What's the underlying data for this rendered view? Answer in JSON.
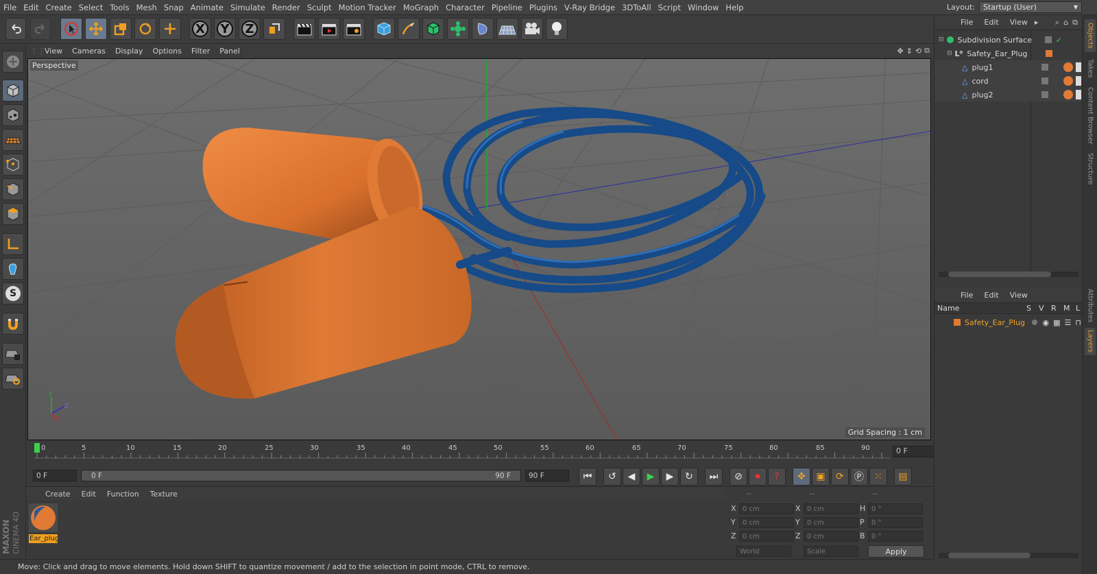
{
  "menubar": {
    "items": [
      "File",
      "Edit",
      "Create",
      "Select",
      "Tools",
      "Mesh",
      "Snap",
      "Animate",
      "Simulate",
      "Render",
      "Sculpt",
      "Motion Tracker",
      "MoGraph",
      "Character",
      "Pipeline",
      "Plugins",
      "V-Ray Bridge",
      "3DToAll",
      "Script",
      "Window",
      "Help"
    ],
    "layout_label": "Layout:",
    "layout_value": "Startup (User)"
  },
  "toolbar": {
    "x_label": "X",
    "y_label": "Y",
    "z_label": "Z"
  },
  "viewport": {
    "menu": [
      "View",
      "Cameras",
      "Display",
      "Options",
      "Filter",
      "Panel"
    ],
    "label": "Perspective",
    "grid_spacing": "Grid Spacing : 1 cm",
    "axis_y": "Y",
    "axis_z": "Z",
    "axis_x": "X",
    "colors": {
      "orange": "#e07a35",
      "blue": "#1a4d8a"
    }
  },
  "timeline": {
    "ticks": [
      "0",
      "5",
      "10",
      "15",
      "20",
      "25",
      "30",
      "35",
      "40",
      "45",
      "50",
      "55",
      "60",
      "65",
      "70",
      "75",
      "80",
      "85",
      "90"
    ],
    "end_field": "0 F"
  },
  "transport": {
    "current_frame": "0 F",
    "range_start": "0 F",
    "range_end": "90 F",
    "max_frame": "90 F"
  },
  "material_panel": {
    "menu": [
      "Create",
      "Edit",
      "Function",
      "Texture"
    ],
    "materials": [
      {
        "name": "Ear_plug"
      }
    ]
  },
  "coordinates": {
    "header_1": "--",
    "header_2": "--",
    "header_3": "--",
    "rows": [
      {
        "a": "X",
        "av": "0 cm",
        "b": "X",
        "bv": "0 cm",
        "c": "H",
        "cv": "0 °"
      },
      {
        "a": "Y",
        "av": "0 cm",
        "b": "Y",
        "bv": "0 cm",
        "c": "P",
        "cv": "0 °"
      },
      {
        "a": "Z",
        "av": "0 cm",
        "b": "Z",
        "bv": "0 cm",
        "c": "B",
        "cv": "0 °"
      }
    ],
    "mode_world": "World",
    "mode_scale": "Scale",
    "apply": "Apply"
  },
  "status": {
    "text": "Move: Click and drag to move elements. Hold down SHIFT to quantize movement / add to the selection in point mode, CTRL to remove."
  },
  "objects_panel": {
    "menu": [
      "File",
      "Edit",
      "View"
    ],
    "items": [
      {
        "name": "Subdivision Surface"
      },
      {
        "name": "Safety_Ear_Plug"
      },
      {
        "name": "plug1"
      },
      {
        "name": "cord"
      },
      {
        "name": "plug2"
      }
    ]
  },
  "layers_panel": {
    "menu": [
      "File",
      "Edit",
      "View"
    ],
    "col_name": "Name",
    "col_s": "S",
    "col_v": "V",
    "col_r": "R",
    "col_m": "M",
    "col_l": "L",
    "layers": [
      {
        "name": "Safety_Ear_Plug",
        "color": "#e07a35"
      }
    ]
  },
  "right_tabs": [
    "Objects",
    "Takes",
    "Content Browser",
    "Structure",
    "Attributes",
    "Layers"
  ],
  "brand": {
    "line1": "MAXON",
    "line2": "CINEMA 4D"
  }
}
